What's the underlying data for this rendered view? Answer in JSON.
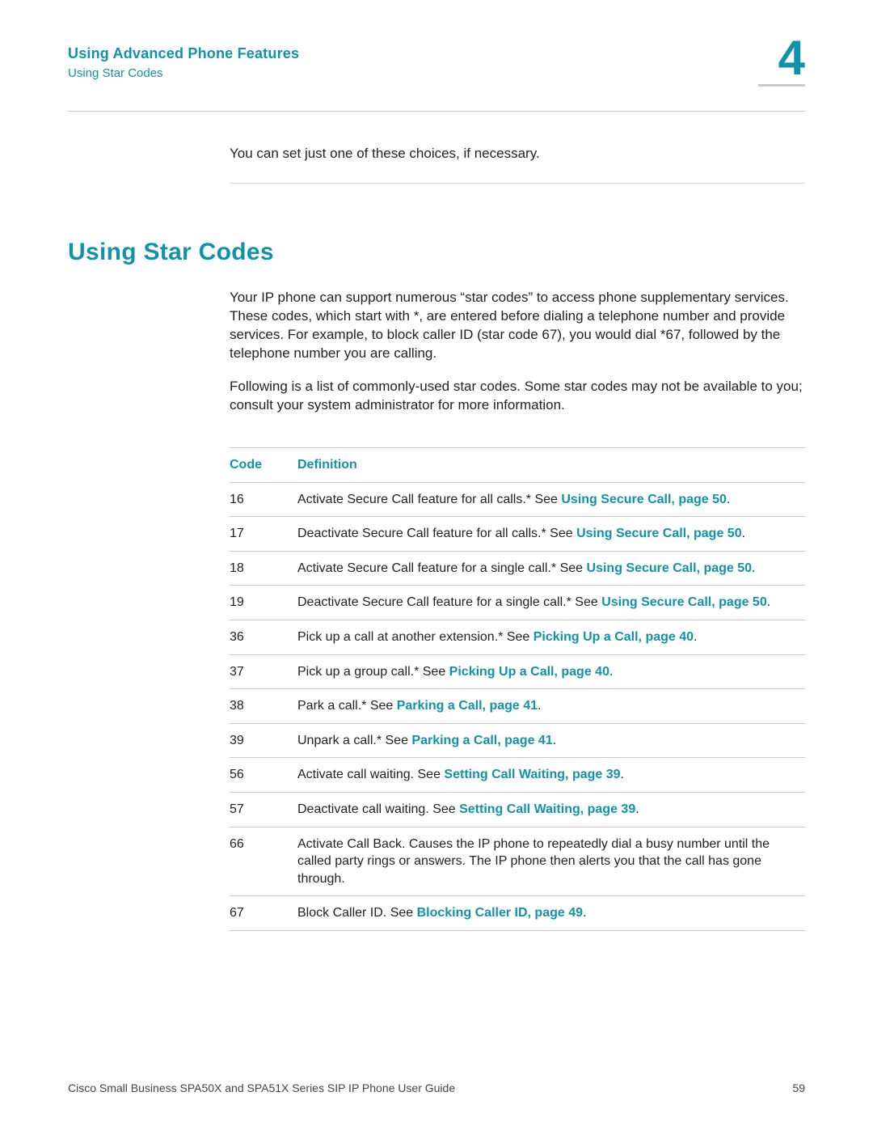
{
  "header": {
    "chapter_title": "Using Advanced Phone Features",
    "breadcrumb": "Using Star Codes",
    "chapter_number": "4"
  },
  "intro_line": "You can set just one of these choices, if necessary.",
  "section_heading": "Using Star Codes",
  "paragraphs": [
    "Your IP phone can support numerous “star codes” to access phone supplementary services. These codes, which start with *, are entered before dialing a telephone number and provide services. For example, to block caller ID (star code 67), you would dial *67, followed by the telephone number you are calling.",
    "Following is a list of commonly-used star codes. Some star codes may not be available to you; consult your system administrator for more information."
  ],
  "table": {
    "headers": {
      "code": "Code",
      "definition": "Definition"
    },
    "rows": [
      {
        "code": "16",
        "def_prefix": "Activate Secure Call feature for all calls.* See ",
        "def_link": "Using Secure Call, page 50",
        "def_suffix": "."
      },
      {
        "code": "17",
        "def_prefix": "Deactivate Secure Call feature for all calls.* See ",
        "def_link": "Using Secure Call, page 50",
        "def_suffix": "."
      },
      {
        "code": "18",
        "def_prefix": "Activate Secure Call feature for a single call.* See ",
        "def_link": "Using Secure Call, page 50",
        "def_suffix": "."
      },
      {
        "code": "19",
        "def_prefix": "Deactivate Secure Call feature for a single call.* See ",
        "def_link": "Using Secure Call, page 50",
        "def_suffix": "."
      },
      {
        "code": "36",
        "def_prefix": "Pick up a call at another extension.* See ",
        "def_link": "Picking Up a Call, page 40",
        "def_suffix": "."
      },
      {
        "code": "37",
        "def_prefix": "Pick up a group call.* See ",
        "def_link": "Picking Up a Call, page 40",
        "def_suffix": "."
      },
      {
        "code": "38",
        "def_prefix": "Park a call.* See ",
        "def_link": "Parking a Call, page 41",
        "def_suffix": "."
      },
      {
        "code": "39",
        "def_prefix": "Unpark a call.* See ",
        "def_link": "Parking a Call, page 41",
        "def_suffix": "."
      },
      {
        "code": "56",
        "def_prefix": "Activate call waiting. See ",
        "def_link": "Setting Call Waiting, page 39",
        "def_suffix": "."
      },
      {
        "code": "57",
        "def_prefix": "Deactivate call waiting. See ",
        "def_link": "Setting Call Waiting, page 39",
        "def_suffix": "."
      },
      {
        "code": "66",
        "def_prefix": "Activate Call Back. Causes the IP phone to repeatedly dial a busy number until the called party rings or answers. The IP phone then alerts you that the call has gone through.",
        "def_link": "",
        "def_suffix": ""
      },
      {
        "code": "67",
        "def_prefix": "Block Caller ID. See ",
        "def_link": "Blocking Caller ID, page 49",
        "def_suffix": "."
      }
    ]
  },
  "footer": {
    "left": "Cisco Small Business SPA50X and SPA51X Series SIP IP Phone User Guide",
    "right": "59"
  }
}
